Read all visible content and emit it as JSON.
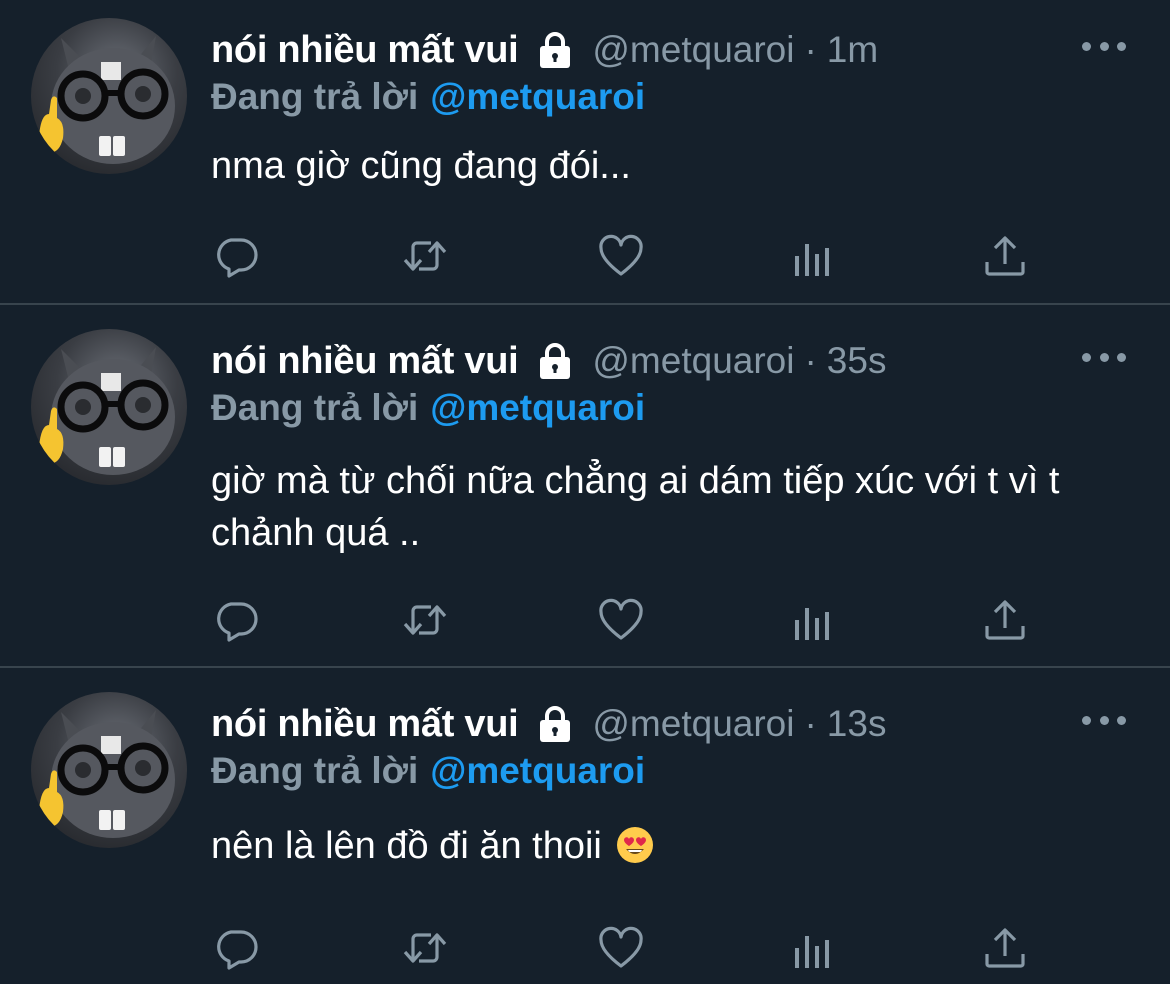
{
  "colors": {
    "background": "#15202b",
    "text": "#ffffff",
    "secondary": "#8899a6",
    "accent": "#1d9bf0",
    "divider": "#38444d"
  },
  "tweets": [
    {
      "author_name": "nói nhiều mất vui",
      "handle": "@metquaroi",
      "separator": "·",
      "time": "1m",
      "reply_label": "Đang trả lời",
      "reply_mention": "@metquaroi",
      "text": "nma giờ cũng đang đói...",
      "icons": [
        "lock-icon",
        "more-icon",
        "reply-icon",
        "retweet-icon",
        "like-icon",
        "analytics-icon",
        "share-icon"
      ]
    },
    {
      "author_name": "nói nhiều mất vui",
      "handle": "@metquaroi",
      "separator": "·",
      "time": "35s",
      "reply_label": "Đang trả lời",
      "reply_mention": "@metquaroi",
      "text": "giờ mà từ chối nữa chẳng ai dám tiếp xúc với t vì t chảnh quá ..",
      "icons": [
        "lock-icon",
        "more-icon",
        "reply-icon",
        "retweet-icon",
        "like-icon",
        "analytics-icon",
        "share-icon"
      ]
    },
    {
      "author_name": "nói nhiều mất vui",
      "handle": "@metquaroi",
      "separator": "·",
      "time": "13s",
      "reply_label": "Đang trả lời",
      "reply_mention": "@metquaroi",
      "text": "nên là lên đồ đi ăn thoii",
      "emoji": "heart-eyes-emoji",
      "icons": [
        "lock-icon",
        "more-icon",
        "reply-icon",
        "retweet-icon",
        "like-icon",
        "analytics-icon",
        "share-icon"
      ]
    }
  ]
}
